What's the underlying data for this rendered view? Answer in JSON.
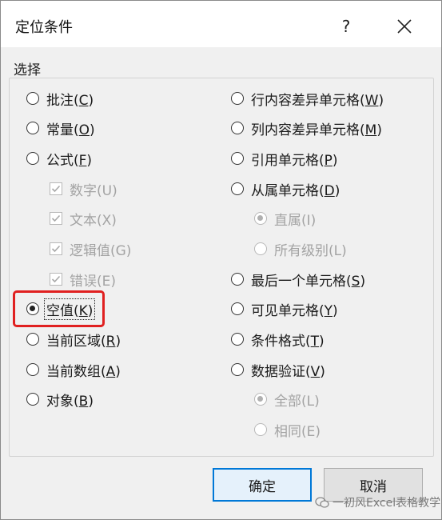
{
  "dialog": {
    "title": "定位条件",
    "help_glyph": "?",
    "group_label": "选择"
  },
  "left_options": [
    {
      "label": "批注(",
      "key": "C",
      "end": ")",
      "state": "unchecked"
    },
    {
      "label": "常量(",
      "key": "O",
      "end": ")",
      "state": "unchecked"
    },
    {
      "label": "公式(",
      "key": "F",
      "end": ")",
      "state": "unchecked"
    },
    {
      "label": "数字(U)",
      "state": "checked-disabled"
    },
    {
      "label": "文本(X)",
      "state": "checked-disabled"
    },
    {
      "label": "逻辑值(G)",
      "state": "checked-disabled"
    },
    {
      "label": "错误(E)",
      "state": "checked-disabled"
    },
    {
      "label": "空值(",
      "key": "K",
      "end": ")",
      "state": "selected"
    },
    {
      "label": "当前区域(",
      "key": "R",
      "end": ")",
      "state": "unchecked"
    },
    {
      "label": "当前数组(",
      "key": "A",
      "end": ")",
      "state": "unchecked"
    },
    {
      "label": "对象(",
      "key": "B",
      "end": ")",
      "state": "unchecked"
    }
  ],
  "right_options": [
    {
      "label": "行内容差异单元格(",
      "key": "W",
      "end": ")",
      "state": "unchecked"
    },
    {
      "label": "列内容差异单元格(",
      "key": "M",
      "end": ")",
      "state": "unchecked"
    },
    {
      "label": "引用单元格(",
      "key": "P",
      "end": ")",
      "state": "unchecked"
    },
    {
      "label": "从属单元格(",
      "key": "D",
      "end": ")",
      "state": "unchecked"
    },
    {
      "label": "直属(I)",
      "state": "selected-disabled"
    },
    {
      "label": "所有级别(L)",
      "state": "disabled"
    },
    {
      "label": "最后一个单元格(",
      "key": "S",
      "end": ")",
      "state": "unchecked"
    },
    {
      "label": "可见单元格(",
      "key": "Y",
      "end": ")",
      "state": "unchecked"
    },
    {
      "label": "条件格式(",
      "key": "T",
      "end": ")",
      "state": "unchecked"
    },
    {
      "label": "数据验证(",
      "key": "V",
      "end": ")",
      "state": "unchecked"
    },
    {
      "label": "全部(L)",
      "state": "selected-disabled"
    },
    {
      "label": "相同(E)",
      "state": "disabled"
    }
  ],
  "buttons": {
    "ok": "确定",
    "cancel": "取消"
  },
  "watermark": "一初风Excel表格教学",
  "colors": {
    "highlight": "#e02020",
    "primary_button_border": "#0078d7"
  }
}
